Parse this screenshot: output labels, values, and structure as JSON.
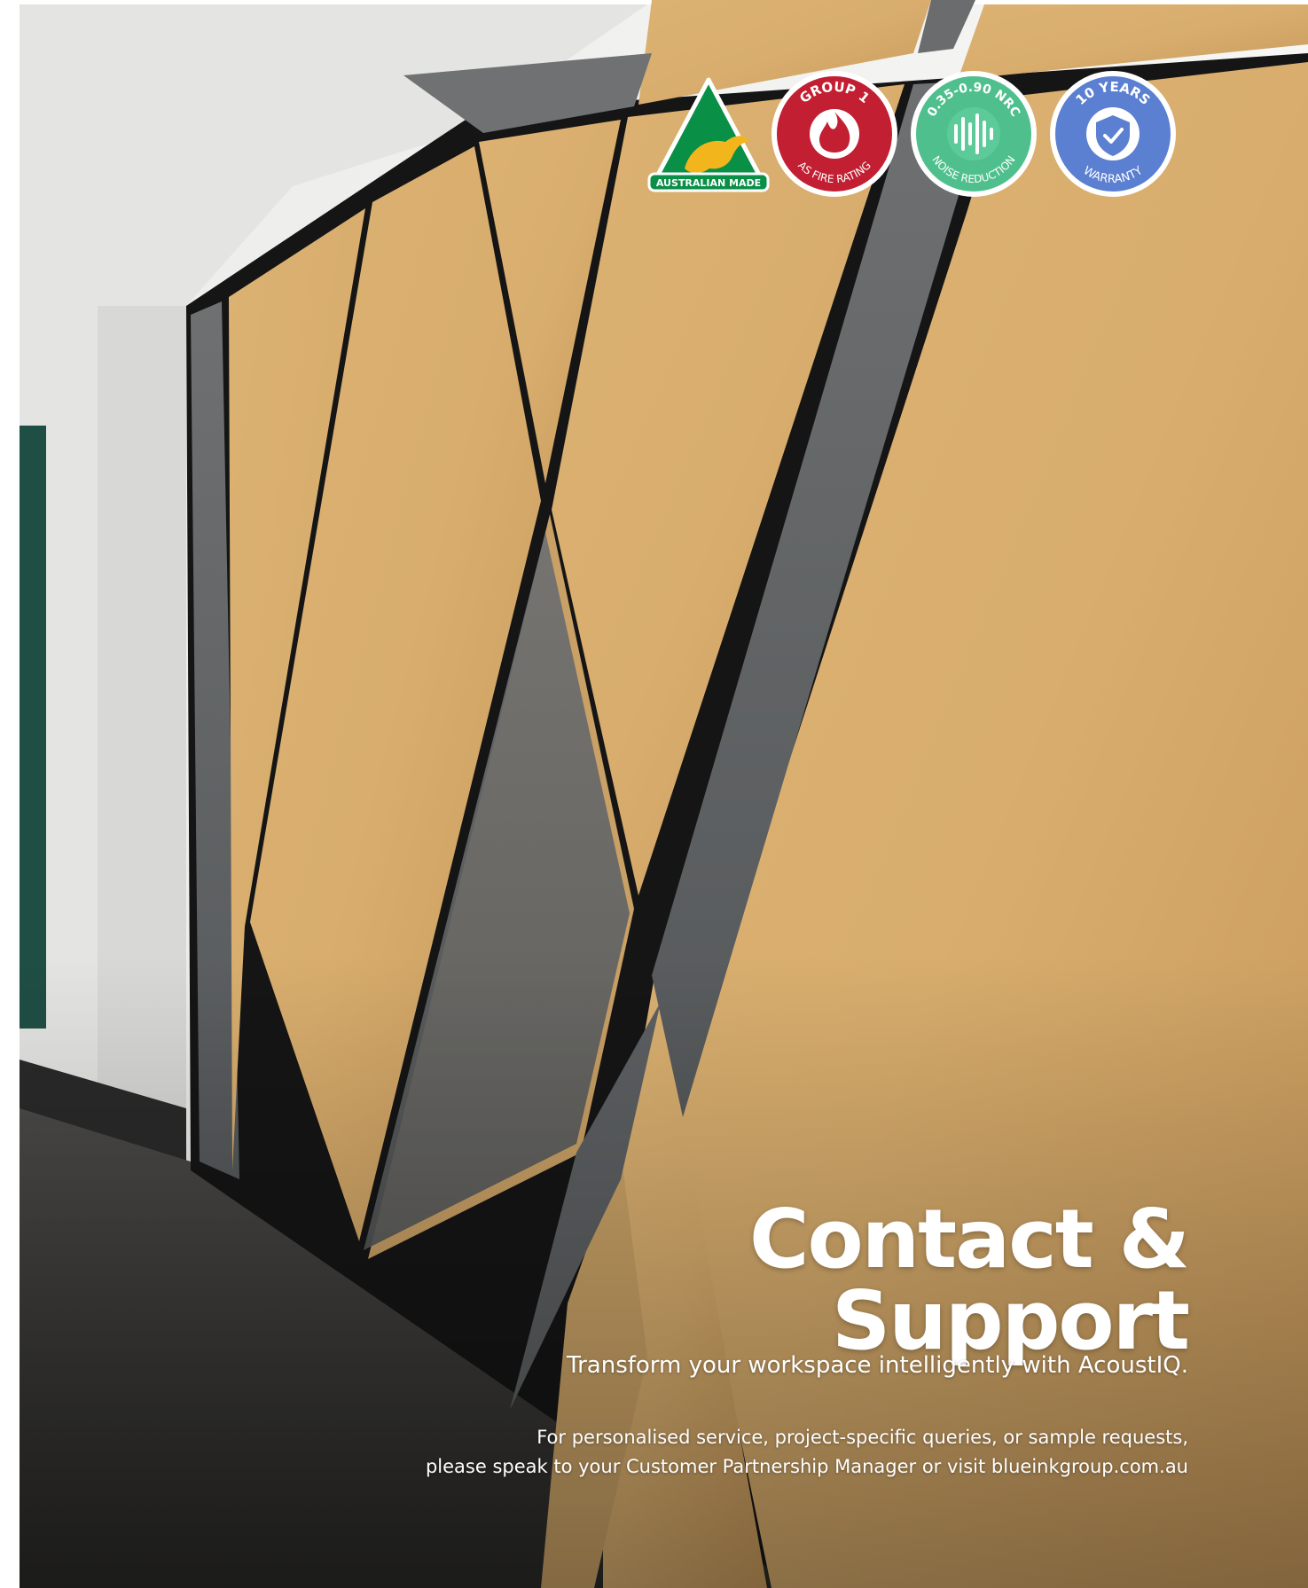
{
  "badges": {
    "australian_made": {
      "label": "AUSTRALIAN MADE",
      "icon": "kangaroo-icon",
      "color": "#0a8f47",
      "accent": "#f2b51c"
    },
    "fire_rating": {
      "top_text": "GROUP 1",
      "bottom_text": "AS FIRE RATING",
      "icon": "flame-icon",
      "color": "#c21f32"
    },
    "noise_reduction": {
      "top_text": "0.35-0.90 NRC",
      "bottom_text": "NOISE REDUCTION",
      "icon": "sound-wave-icon",
      "color": "#4fc08d"
    },
    "warranty": {
      "top_text": "10 YEARS",
      "bottom_text": "WARRANTY",
      "icon": "shield-check-icon",
      "color": "#5b7fd1"
    }
  },
  "heading": "Contact & Support",
  "tagline": "Transform your workspace intelligently with AcoustIQ.",
  "body": {
    "line1": "For personalised service, project-specific queries, or sample requests,",
    "line2": "please speak to your Customer Partnership Manager or visit blueinkgroup.com.au"
  }
}
